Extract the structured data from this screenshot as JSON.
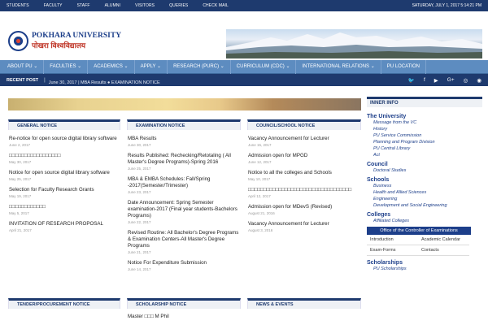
{
  "topbar": {
    "links": [
      "STUDENTS",
      "FACULTY",
      "STAFF",
      "ALUMNI",
      "VISITORS",
      "QUERIES",
      "CHECK MAIL"
    ],
    "date": "SATURDAY, JULY 1, 2017 5:14:21 PM"
  },
  "logo": {
    "name_en": "POKHARA UNIVERSITY",
    "name_np": "पोखरा विश्वविद्यालय"
  },
  "nav": [
    "ABOUT PU ⌄",
    "FACULTIES ⌄",
    "ACADEMICS ⌄",
    "APPLY ⌄",
    "RESEARCH (PURC) ⌄",
    "CURRICULUM (CDC) ⌄",
    "INTERNATIONAL RELATIONS ⌄",
    "PU LOCATION"
  ],
  "recent": {
    "label": "RECENT POST",
    "separator": "|",
    "text": "June 30, 2017 | MBA Results ● EXAMINATION NOTICE",
    "social": [
      "twitter-icon",
      "facebook-icon",
      "youtube-icon",
      "google-plus-icon",
      "instagram-icon",
      "rss-icon"
    ],
    "social_glyphs": [
      "🐦",
      "f",
      "▶",
      "G+",
      "◎",
      "◉"
    ]
  },
  "general": {
    "title": "GENERAL NOTICE",
    "items": [
      {
        "t": "Re-notice for open source digital library software",
        "d": "June 2, 2017"
      },
      {
        "t": "□□□□□□□□□□□□□□□□□",
        "d": "May 30, 2017"
      },
      {
        "t": "Notice for open source digital library software",
        "d": "May 25, 2017"
      },
      {
        "t": "Selection for Faculty Research Grants",
        "d": "May 19, 2017"
      },
      {
        "t": "□□□□□□□□□□□□",
        "d": "May 5, 2017"
      },
      {
        "t": "INVITATION OF RESEARCH PROPOSAL",
        "d": "April 21, 2017"
      }
    ]
  },
  "exam": {
    "title": "EXAMINATION NOTICE",
    "items": [
      {
        "t": "MBA Results",
        "d": "June 30, 2017"
      },
      {
        "t": "Results Published: Rechecking/Retotaling ( All Master's Degree Programs)-Spring 2016",
        "d": "June 25, 2017"
      },
      {
        "t": "MBA & EMBA Schedules: Fall/Spring -2017(Semester/Trimester)",
        "d": "June 23, 2017"
      },
      {
        "t": "Date Announcement: Spring Semester examination-2017 (Final year students-Bachelors Programs)",
        "d": "June 22, 2017"
      },
      {
        "t": "Revised Routine: All Bachelor's Degree Programs & Examination Centers-All Master's Degree Programs",
        "d": "June 21, 2017"
      },
      {
        "t": "Notice For Expenditure Submission",
        "d": "June 14, 2017"
      }
    ]
  },
  "council": {
    "title": "COUNCIL/SCHOOL NOTICE",
    "items": [
      {
        "t": "Vacancy Announcement for Lecturer",
        "d": "June 15, 2017"
      },
      {
        "t": "Admission open for MPGD",
        "d": "June 12, 2017"
      },
      {
        "t": "Notice to all the colleges and Schools",
        "d": "May 10, 2017"
      },
      {
        "t": "□□□□□□□□□□□□□□□□□□□□□□□□□□□□□□□□□□",
        "d": "April 12, 2017"
      },
      {
        "t": "Admission open for MDevS (Revised)",
        "d": "August 21, 2016"
      },
      {
        "t": "Vacancy Announcement for Lecturer",
        "d": "August 3, 2016"
      }
    ]
  },
  "bottom": {
    "tender": "TENDER/PROCUREMENT NOTICE",
    "scholar": "SCHOLARSHIP NOTICE",
    "scholar_item": "Master □□□ M Phil",
    "news": "NEWS & EVENTS"
  },
  "side": {
    "title": "INNER INFO",
    "university": "The University",
    "univ_items": [
      "Message from the VC",
      "History",
      "PU Service Commission",
      "Planning and Program Division",
      "PU Central Library",
      "Act"
    ],
    "council": "Council",
    "council_items": [
      "Doctoral Studies"
    ],
    "schools": "Schools",
    "school_items": [
      "Business",
      "Health and Allied Sciences",
      "Engineering",
      "Development and Social Engineering"
    ],
    "colleges": "Colleges",
    "college_items": [
      "Affiliated Colleges"
    ],
    "coe": "Office of the Controller of Examinations",
    "coe_links": [
      "Introduction",
      "Academic Calendar",
      "Exam-Forms",
      "Contacts"
    ],
    "scholarships": "Scholarships",
    "scholar_items": [
      "PU Scholarships"
    ]
  }
}
